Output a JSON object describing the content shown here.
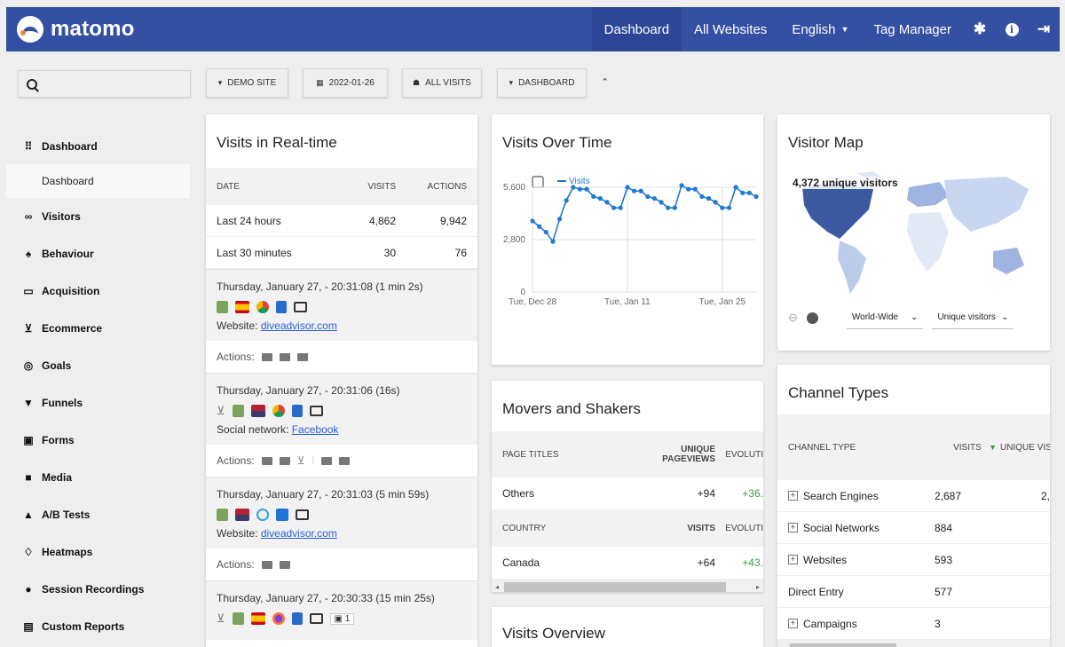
{
  "brand": {
    "name": "matomo"
  },
  "topnav": {
    "dashboard": "Dashboard",
    "all_websites": "All Websites",
    "language": "English",
    "tag_manager": "Tag Manager"
  },
  "toolbar": {
    "search_placeholder": "",
    "site": "DEMO SITE",
    "date": "2022-01-26",
    "segment": "ALL VISITS",
    "dashboard": "DASHBOARD"
  },
  "sidebar": {
    "items": [
      {
        "label": "Dashboard",
        "icon": "grid-icon"
      },
      {
        "label": "Visitors",
        "icon": "binoculars-icon"
      },
      {
        "label": "Behaviour",
        "icon": "bell-icon"
      },
      {
        "label": "Acquisition",
        "icon": "window-icon"
      },
      {
        "label": "Ecommerce",
        "icon": "cart-icon"
      },
      {
        "label": "Goals",
        "icon": "target-icon"
      },
      {
        "label": "Funnels",
        "icon": "funnel-icon"
      },
      {
        "label": "Forms",
        "icon": "form-icon"
      },
      {
        "label": "Media",
        "icon": "media-icon"
      },
      {
        "label": "A/B Tests",
        "icon": "flask-icon"
      },
      {
        "label": "Heatmaps",
        "icon": "flame-icon"
      },
      {
        "label": "Session Recordings",
        "icon": "record-icon"
      },
      {
        "label": "Custom Reports",
        "icon": "reports-icon"
      }
    ],
    "sub_dashboard": "Dashboard"
  },
  "realtime": {
    "title": "Visits in Real-time",
    "columns": [
      "DATE",
      "VISITS",
      "ACTIONS"
    ],
    "rows": [
      {
        "date": "Last 24 hours",
        "visits": "4,862",
        "actions": "9,942"
      },
      {
        "date": "Last 30 minutes",
        "visits": "30",
        "actions": "76"
      }
    ],
    "visits": [
      {
        "time": "Thursday, January 27, - 20:31:08 (1 min 2s)",
        "source_label": "Website:",
        "source": "diveadvisor.com"
      },
      {
        "time": "Thursday, January 27, - 20:31:06 (16s)",
        "source_label": "Social network:",
        "source": "Facebook"
      },
      {
        "time": "Thursday, January 27, - 20:31:03 (5 min 59s)",
        "source_label": "Website:",
        "source": "diveadvisor.com"
      },
      {
        "time": "Thursday, January 27, - 20:30:33 (15 min 25s)",
        "badge": "1"
      }
    ],
    "actions_label": "Actions:"
  },
  "visits_over_time": {
    "title": "Visits Over Time",
    "legend": "Visits"
  },
  "chart_data": {
    "type": "line",
    "title": "Visits Over Time",
    "series": [
      {
        "name": "Visits",
        "values": [
          3800,
          3500,
          3200,
          2700,
          3900,
          4900,
          5600,
          5500,
          5500,
          5100,
          5000,
          4800,
          4500,
          4500,
          5600,
          5400,
          5400,
          5100,
          5000,
          4800,
          4500,
          4500,
          5700,
          5500,
          5500,
          5100,
          5000,
          4800,
          4500,
          4500,
          5600,
          5300,
          5300,
          5100
        ]
      }
    ],
    "x_tick_labels": [
      "Tue, Dec 28",
      "Tue, Jan 11",
      "Tue, Jan 25"
    ],
    "y_tick_labels": [
      "0",
      "2,800",
      "5,600"
    ],
    "ylim": [
      0,
      5600
    ],
    "grid": true,
    "color": "#1f78d1"
  },
  "visitor_map": {
    "title": "Visitor Map",
    "summary": "4,372 unique visitors",
    "region": "World-Wide",
    "metric": "Unique visitors"
  },
  "movers": {
    "title": "Movers and Shakers",
    "page_titles_head": [
      "PAGE TITLES",
      "UNIQUE PAGEVIEWS",
      "EVOLUTI"
    ],
    "page_row": {
      "label": "Others",
      "value": "+94",
      "evolution": "+36."
    },
    "country_head": [
      "COUNTRY",
      "VISITS",
      "EVOLUTI"
    ],
    "country_row": {
      "label": "Canada",
      "value": "+64",
      "evolution": "+43."
    }
  },
  "visits_overview": {
    "title": "Visits Overview"
  },
  "channels": {
    "title": "Channel Types",
    "columns": [
      "CHANNEL TYPE",
      "VISITS",
      "UNIQUE VISIT"
    ],
    "rows": [
      {
        "label": "Search Engines",
        "visits": "2,687",
        "unique": "2,",
        "expandable": true
      },
      {
        "label": "Social Networks",
        "visits": "884",
        "unique": "",
        "expandable": true
      },
      {
        "label": "Websites",
        "visits": "593",
        "unique": "",
        "expandable": true
      },
      {
        "label": "Direct Entry",
        "visits": "577",
        "unique": "",
        "expandable": false
      },
      {
        "label": "Campaigns",
        "visits": "3",
        "unique": "",
        "expandable": true
      }
    ]
  },
  "colors": {
    "brand": "#3450a3",
    "positive": "#3a9e3a",
    "chart": "#1f78d1",
    "link": "#2b5fd9"
  }
}
